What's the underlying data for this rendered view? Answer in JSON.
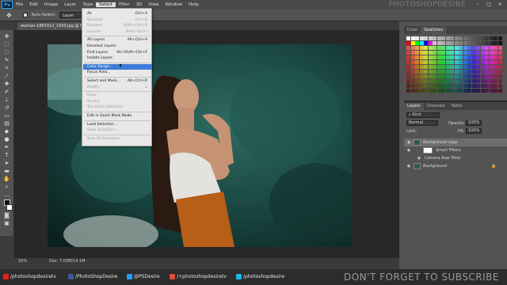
{
  "app": {
    "logo": "Ps",
    "watermark": "PHOTOSHOPDESIRE"
  },
  "menubar": [
    "File",
    "Edit",
    "Image",
    "Layer",
    "Type",
    "Select",
    "Filter",
    "3D",
    "View",
    "Window",
    "Help"
  ],
  "options": {
    "auto_select_label": "Auto-Select:",
    "auto_select_value": "Layer"
  },
  "document": {
    "tab_title": "woman-1893312_1920.jpg @ 5",
    "zoom": "50%",
    "doc_size": "Doc: 7.03M/14.1M"
  },
  "select_menu": {
    "items": [
      {
        "label": "All",
        "shortcut": "Ctrl+A",
        "disabled": false
      },
      {
        "label": "Deselect",
        "shortcut": "Ctrl+D",
        "disabled": true
      },
      {
        "label": "Reselect",
        "shortcut": "Shift+Ctrl+D",
        "disabled": true
      },
      {
        "label": "Inverse",
        "shortcut": "Shift+Ctrl+I",
        "disabled": true
      },
      {
        "label": "All Layers",
        "shortcut": "Alt+Ctrl+A",
        "disabled": false
      },
      {
        "label": "Deselect Layers",
        "shortcut": "",
        "disabled": false
      },
      {
        "label": "Find Layers",
        "shortcut": "Alt+Shift+Ctrl+F",
        "disabled": false
      },
      {
        "label": "Isolate Layers",
        "shortcut": "",
        "disabled": false
      },
      {
        "label": "Color Range...",
        "shortcut": "",
        "disabled": false,
        "highlighted": true
      },
      {
        "label": "Focus Area...",
        "shortcut": "",
        "disabled": false
      },
      {
        "label": "Select and Mask...",
        "shortcut": "Alt+Ctrl+R",
        "disabled": false
      },
      {
        "label": "Modify",
        "shortcut": "",
        "disabled": true
      },
      {
        "label": "Grow",
        "shortcut": "",
        "disabled": true
      },
      {
        "label": "Similar",
        "shortcut": "",
        "disabled": true
      },
      {
        "label": "Transform Selection",
        "shortcut": "",
        "disabled": true
      },
      {
        "label": "Edit in Quick Mask Mode",
        "shortcut": "",
        "disabled": false
      },
      {
        "label": "Load Selection...",
        "shortcut": "",
        "disabled": false
      },
      {
        "label": "Save Selection...",
        "shortcut": "",
        "disabled": true
      },
      {
        "label": "New 3D Extrusion",
        "shortcut": "",
        "disabled": true
      }
    ]
  },
  "swatches_panel": {
    "tabs": [
      "Color",
      "Swatches"
    ],
    "active": "Swatches"
  },
  "layers_panel": {
    "tabs": [
      "Layers",
      "Channels",
      "Paths"
    ],
    "kind": "Kind",
    "blend_mode": "Normal",
    "opacity_label": "Opacity:",
    "opacity": "100%",
    "lock_label": "Lock:",
    "fill_label": "Fill:",
    "fill": "100%",
    "layers": [
      {
        "name": "Background copy"
      },
      {
        "name": "Smart Filters"
      },
      {
        "name": "Camera Raw Filter"
      },
      {
        "name": "Background"
      }
    ]
  },
  "footer": {
    "links": [
      "/photoshopdesiretv",
      "/PhotoShopDesire",
      "@PSDesire",
      "/+photoshopdesiretv",
      "/photoshopdesire"
    ],
    "slogan": "DON'T FORGET TO SUBSCRIBE"
  },
  "colors": {
    "menu_highlight": "#3d7bd8",
    "youtube": "#e62117",
    "facebook": "#3b5998",
    "twitter": "#1da1f2",
    "gplus": "#dd4b39",
    "vimeo": "#1ab7ea"
  }
}
